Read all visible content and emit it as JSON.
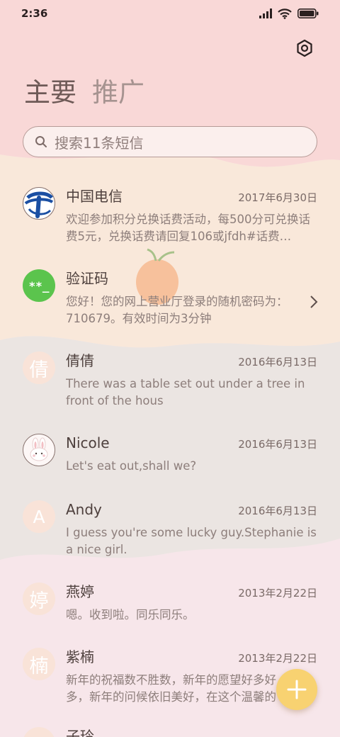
{
  "status": {
    "time": "2:36"
  },
  "tabs": [
    {
      "label": "主要",
      "active": true
    },
    {
      "label": "推广",
      "active": false
    }
  ],
  "search": {
    "placeholder": "搜索11条短信"
  },
  "conversations": [
    {
      "name": "中国电信",
      "date": "2017年6月30日",
      "preview": "欢迎参加积分兑换话费活动，每500分可兑换话费5元，兑换话费请回复106或jfdh#话费…",
      "avatar": "china-telecom-logo"
    },
    {
      "name": "验证码",
      "date": "",
      "preview": "您好！您的网上营业厅登录的随机密码为：710679。有效时间为3分钟",
      "avatar": "**_"
    },
    {
      "name": "倩倩",
      "date": "2016年6月13日",
      "preview": "There was a table set out under a tree in front of the hous",
      "avatar": "倩"
    },
    {
      "name": "Nicole",
      "date": "2016年6月13日",
      "preview": "Let's eat out,shall we?",
      "avatar": "bunny-avatar"
    },
    {
      "name": "Andy",
      "date": "2016年6月13日",
      "preview": "I guess you're some lucky guy.Stephanie is a nice girl.",
      "avatar": "A"
    },
    {
      "name": "燕婷",
      "date": "2013年2月22日",
      "preview": "嗯。收到啦。同乐同乐。",
      "avatar": "婷"
    },
    {
      "name": "紫楠",
      "date": "2013年2月22日",
      "preview": "新年的祝福数不胜数，新年的愿望好多好多，新年的问候依旧美好，在这个温馨的时刻",
      "avatar": "楠"
    },
    {
      "name": "子玲",
      "date": "",
      "preview": "",
      "avatar": ""
    }
  ],
  "colors": {
    "accent": "#f8d271",
    "text": "#4e403d",
    "pink": "#f9d8d7",
    "peach": "#f9e8da",
    "gray": "#ebe5e2",
    "lavender": "#f7e6ea"
  }
}
